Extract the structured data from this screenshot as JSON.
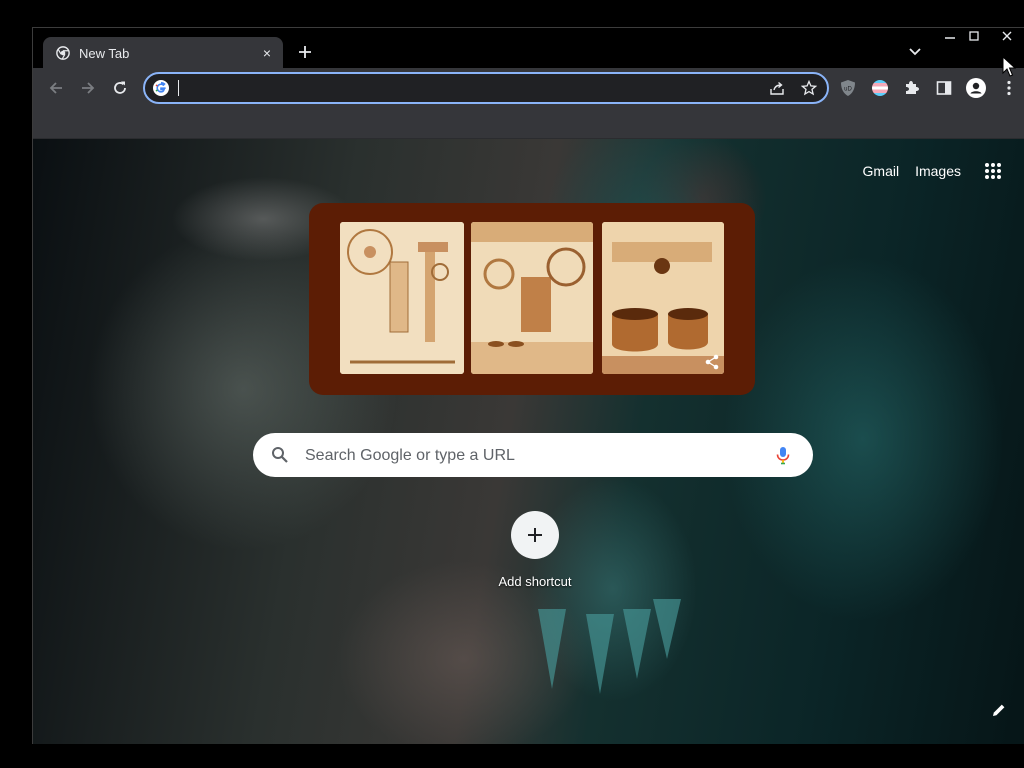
{
  "tab": {
    "title": "New Tab",
    "close_glyph": "×"
  },
  "tabstrip": {
    "new_tab_glyph": "+",
    "tab_search_icon": "chevron-down-icon"
  },
  "window_controls": {
    "minimize_icon": "minimize-icon",
    "maximize_icon": "maximize-icon",
    "close_icon": "close-icon"
  },
  "toolbar": {
    "back_icon": "arrow-left-icon",
    "forward_icon": "arrow-right-icon",
    "reload_icon": "reload-icon",
    "omnibox": {
      "value": "",
      "placeholder": "",
      "focused": true
    },
    "omnibox_icons": [
      "share-icon",
      "star-icon"
    ],
    "extensions": [
      "ublock-icon",
      "pride-flag-icon",
      "puzzle-icon",
      "side-panel-icon",
      "profile-icon",
      "more-vert-icon"
    ]
  },
  "colors": {
    "accent_focus": "#8ab4f8",
    "toolbar_bg": "#35363a",
    "tabstrip_bg": "#000000",
    "doodle_bg": "#5c1d05"
  },
  "ntp": {
    "top_links": [
      "Gmail",
      "Images"
    ],
    "apps_icon": "apps-grid-icon",
    "doodle_panels": [
      "doodle-panel-machine",
      "doodle-panel-espresso",
      "doodle-panel-coffee-cups"
    ],
    "search": {
      "placeholder": "Search Google or type a URL",
      "value": ""
    },
    "shortcut": {
      "label": "Add shortcut",
      "icon": "plus-icon"
    },
    "customize_icon": "pencil-icon"
  }
}
